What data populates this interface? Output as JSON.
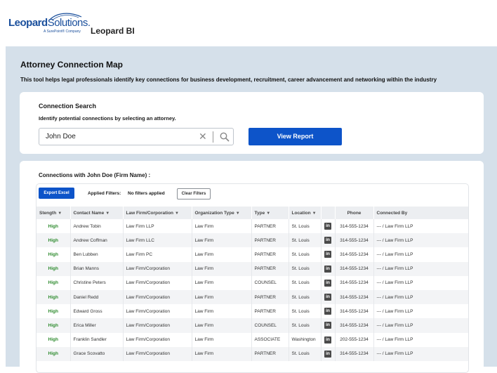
{
  "header": {
    "logo_text_bold": "Leopard",
    "logo_text_light": "Solutions.",
    "logo_tagline": "A SurePoint® Company",
    "app_name": "Leopard BI"
  },
  "page": {
    "title": "Attorney Connection Map",
    "description": "This tool helps legal professionals identify key connections for business development, recruitment, career advancement and networking within the industry"
  },
  "search": {
    "title": "Connection Search",
    "hint": "Identify potential connections by selecting  an attorney.",
    "value": "John Doe",
    "clear_glyph": "✕",
    "view_button": "View Report"
  },
  "results": {
    "title": "Connections with John Doe (Firm Name) :",
    "export_button": "Export Excel",
    "applied_filters_label": "Applied Filters:",
    "applied_filters_value": "No filters applied",
    "clear_filters_button": "Clear Filters",
    "filter_glyph": "▼",
    "linkedin_glyph": "in",
    "columns": [
      "Stength",
      "Contact Name",
      "Law Firm/Corporation",
      "Organization Type",
      "Type",
      "Location",
      "",
      "Phone",
      "Connected By"
    ],
    "rows": [
      [
        "High",
        "Andrew Tobin",
        "Law Firm LLP",
        "Law Firm",
        "PARTNER",
        "St. Louis",
        "314-555-1234",
        "--- / Law Firm LLP"
      ],
      [
        "High",
        "Andrew Coffman",
        "Law Firm LLC",
        "Law Firm",
        "PARTNER",
        "St. Louis",
        "314-555-1234",
        "--- / Law Firm LLP"
      ],
      [
        "High",
        "Ben Lubben",
        "Law Firm PC",
        "Law Firm",
        "PARTNER",
        "St. Louis",
        "314-555-1234",
        "--- / Law Firm LLP"
      ],
      [
        "High",
        "Brian Manns",
        "Law Firm/Corporation",
        "Law Firm",
        "PARTNER",
        "St. Louis",
        "314-555-1234",
        "--- / Law Firm LLP"
      ],
      [
        "High",
        "Christine Peters",
        "Law Firm/Corporation",
        "Law Firm",
        "COUNSEL",
        "St. Louis",
        "314-555-1234",
        "--- / Law Firm LLP"
      ],
      [
        "High",
        "Daniel Redd",
        "Law Firm/Corporation",
        "Law Firm",
        "PARTNER",
        "St. Louis",
        "314-555-1234",
        "--- / Law Firm LLP"
      ],
      [
        "High",
        "Edward Gross",
        "Law Firm/Corporation",
        "Law Firm",
        "PARTNER",
        "St. Louis",
        "314-555-1234",
        "--- / Law Firm LLP"
      ],
      [
        "High",
        "Erica Miller",
        "Law Firm/Corporation",
        "Law Firm",
        "COUNSEL",
        "St. Louis",
        "314-555-1234",
        "--- / Law Firm LLP"
      ],
      [
        "High",
        "Franklin Sandler",
        "Law Firm/Corporation",
        "Law Firm",
        "ASSOCIATE",
        "Washington",
        "202-555-1234",
        "--- / Law Firm LLP"
      ],
      [
        "High",
        "Grace Scovatto",
        "Law Firm/Corporation",
        "Law Firm",
        "PARTNER",
        "St. Louis",
        "314-555-1234",
        "--- / Law Firm LLP"
      ]
    ]
  },
  "colors": {
    "accent": "#0d54c9",
    "background": "#d5e0ea",
    "strength_high": "#2e8b2e",
    "brand": "#1a4f9c"
  }
}
